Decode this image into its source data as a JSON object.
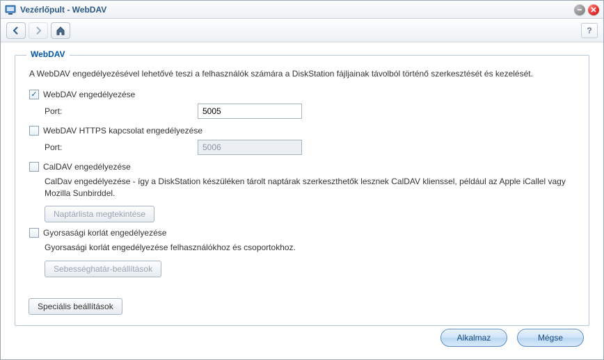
{
  "window": {
    "title": "Vezérlőpult - WebDAV"
  },
  "toolbar": {
    "help": "?"
  },
  "fieldset": {
    "legend": "WebDAV",
    "description": "A WebDAV engedélyezésével lehetővé teszi a felhasználók számára a DiskStation fájljainak távolból történő szerkesztését és kezelését.",
    "webdav_enable": {
      "label": "WebDAV engedélyezése",
      "checked": true,
      "port_label": "Port:",
      "port_value": "5005"
    },
    "webdav_https": {
      "label": "WebDAV HTTPS kapcsolat engedélyezése",
      "checked": false,
      "port_label": "Port:",
      "port_value": "5006"
    },
    "caldav": {
      "label": "CalDAV engedélyezése",
      "checked": false,
      "info": "CalDav engedélyezése - így a DiskStation készüléken tárolt naptárak szerkeszthetők lesznek CalDAV klienssel, például az Apple iCallel vagy Mozilla Sunbirddel.",
      "button": "Naptárlista megtekintése"
    },
    "speedlimit": {
      "label": "Gyorsasági korlát engedélyezése",
      "checked": false,
      "info": "Gyorsasági korlát engedélyezése felhasználókhoz és csoportokhoz.",
      "button": "Sebességhatár-beállítások"
    },
    "advanced_button": "Speciális beállítások"
  },
  "footer": {
    "apply": "Alkalmaz",
    "cancel": "Mégse"
  }
}
